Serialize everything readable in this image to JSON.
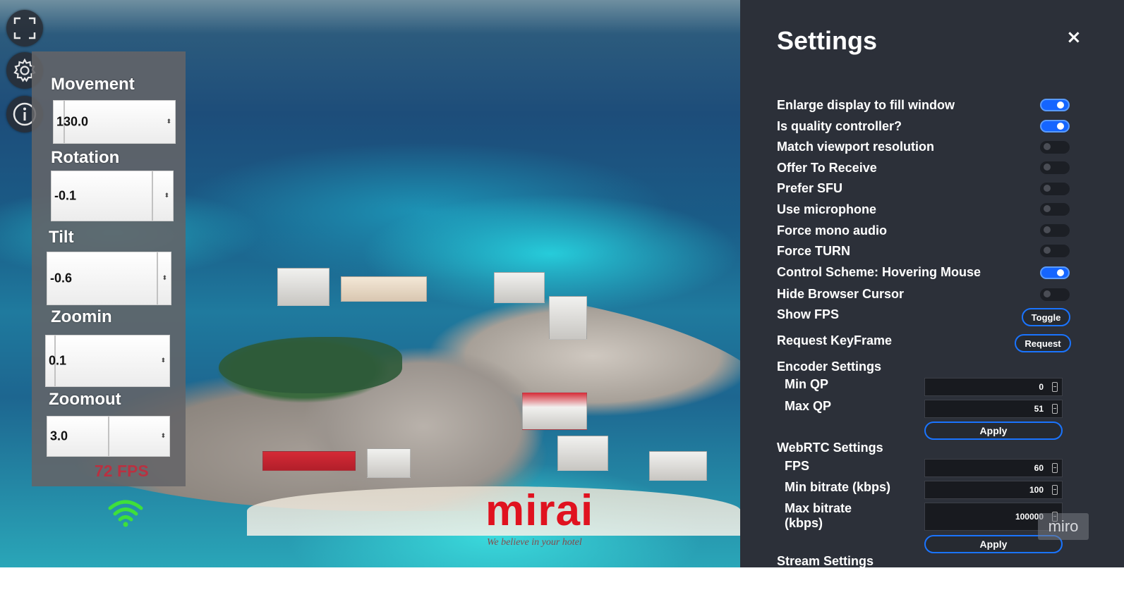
{
  "toolbar": {
    "fullscreen_icon": "fullscreen-icon",
    "settings_icon": "gear-icon",
    "info_icon": "info-icon"
  },
  "controls": {
    "items": [
      {
        "label": "Movement",
        "value": "130.0"
      },
      {
        "label": "Rotation",
        "value": "-0.1"
      },
      {
        "label": "Tilt",
        "value": "-0.6"
      },
      {
        "label": "Zoomin",
        "value": "0.1"
      },
      {
        "label": "Zoomout",
        "value": "3.0"
      }
    ],
    "fps_overlay": "72 FPS"
  },
  "brand": {
    "logo": "mirai",
    "tagline": "We believe in your hotel"
  },
  "settings": {
    "title": "Settings",
    "close_label": "×",
    "toggles": [
      {
        "label": "Enlarge display to fill window",
        "on": true
      },
      {
        "label": "Is quality controller?",
        "on": true
      },
      {
        "label": "Match viewport resolution",
        "on": false
      },
      {
        "label": "Offer To Receive",
        "on": false
      },
      {
        "label": "Prefer SFU",
        "on": false
      },
      {
        "label": "Use microphone",
        "on": false
      },
      {
        "label": "Force mono audio",
        "on": false
      },
      {
        "label": "Force TURN",
        "on": false
      },
      {
        "label": "Control Scheme: Hovering Mouse",
        "on": true
      },
      {
        "label": "Hide Browser Cursor",
        "on": false
      }
    ],
    "show_fps": {
      "label": "Show FPS",
      "button": "Toggle"
    },
    "request_keyframe": {
      "label": "Request KeyFrame",
      "button": "Request"
    },
    "encoder": {
      "title": "Encoder Settings",
      "min_qp": {
        "label": "Min QP",
        "value": "0"
      },
      "max_qp": {
        "label": "Max QP",
        "value": "51"
      },
      "apply": "Apply"
    },
    "webrtc": {
      "title": "WebRTC Settings",
      "fps": {
        "label": "FPS",
        "value": "60"
      },
      "min_bitrate": {
        "label": "Min bitrate (kbps)",
        "value": "100"
      },
      "max_bitrate": {
        "label": "Max bitrate (kbps)",
        "value": "100000"
      },
      "apply": "Apply"
    },
    "next_section_partial": "Stream Settings"
  },
  "watermark": "miro",
  "colors": {
    "accent": "#1a74ff",
    "panel_bg": "#2c3039",
    "fps_text": "#c8283a",
    "logo": "#e0121f",
    "wifi": "#3ee03a"
  }
}
